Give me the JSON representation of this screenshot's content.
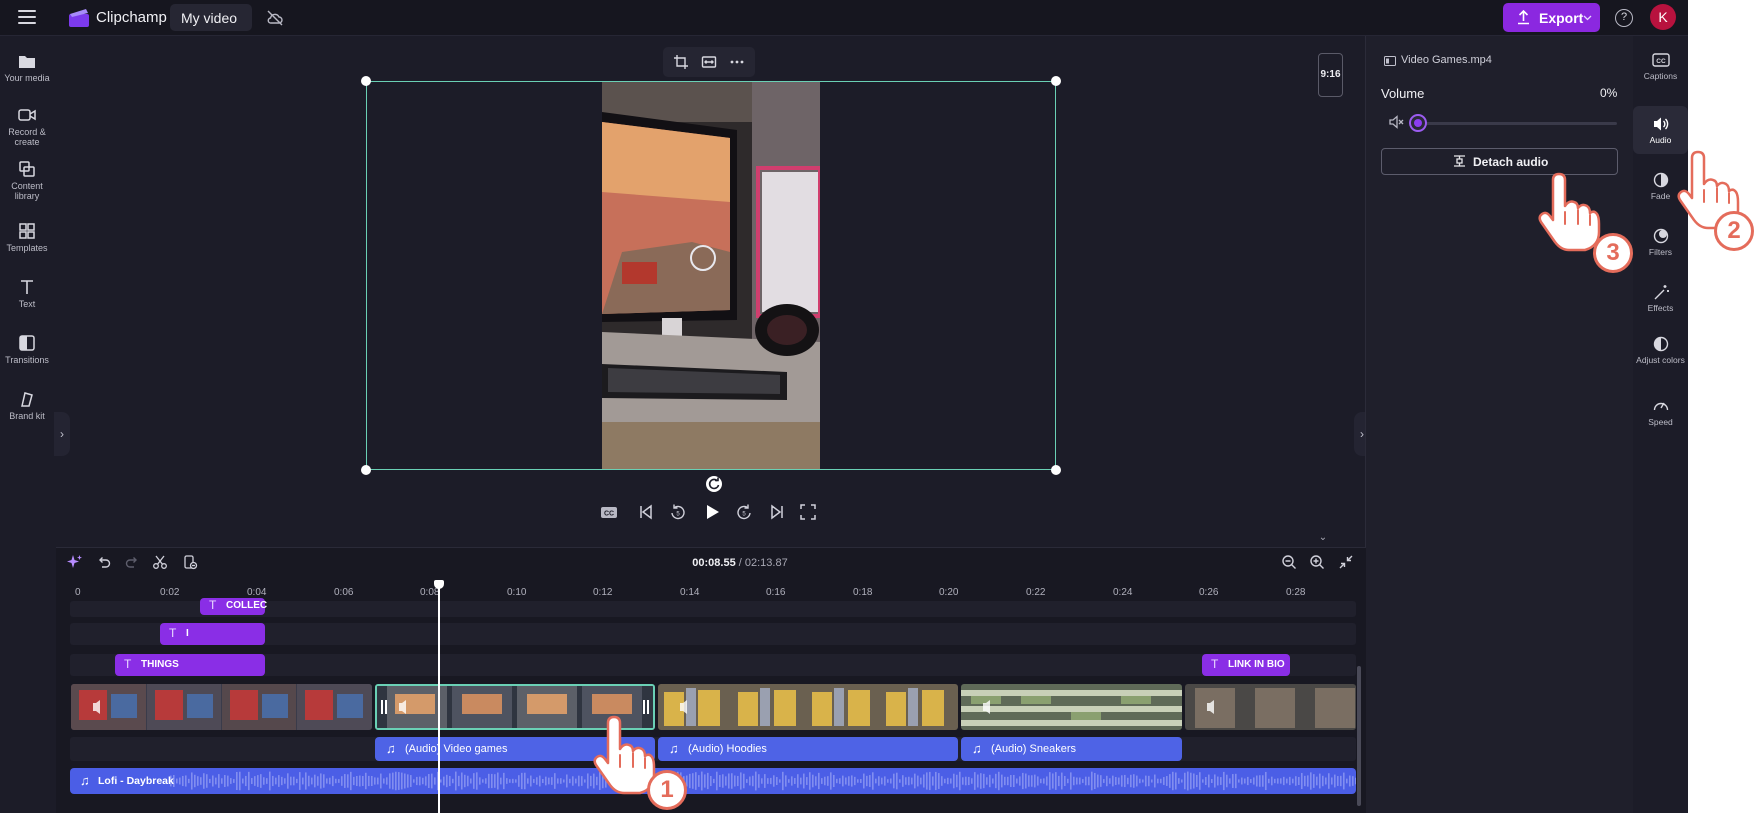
{
  "app": {
    "name": "Clipchamp",
    "project_name": "My video"
  },
  "header": {
    "export_label": "Export",
    "help_label": "?",
    "avatar_initial": "K"
  },
  "sidebar": {
    "items": [
      {
        "label": "Your media",
        "icon": "folder-icon"
      },
      {
        "label": "Record & create",
        "icon": "camera-icon"
      },
      {
        "label": "Content library",
        "icon": "library-icon"
      },
      {
        "label": "Templates",
        "icon": "templates-icon"
      },
      {
        "label": "Text",
        "icon": "text-icon"
      },
      {
        "label": "Transitions",
        "icon": "transitions-icon"
      },
      {
        "label": "Brand kit",
        "icon": "brand-kit-icon"
      }
    ]
  },
  "preview": {
    "aspect_ratio": "9:16"
  },
  "panel": {
    "file_name": "Video Games.mp4",
    "volume_label": "Volume",
    "volume_value": "0%",
    "volume_level": 0,
    "detach_label": "Detach audio"
  },
  "right_tabs": [
    {
      "label": "Captions",
      "icon": "captions-icon"
    },
    {
      "label": "Audio",
      "icon": "audio-icon",
      "active": true
    },
    {
      "label": "Fade",
      "icon": "fade-icon"
    },
    {
      "label": "Filters",
      "icon": "filters-icon"
    },
    {
      "label": "Effects",
      "icon": "effects-icon"
    },
    {
      "label": "Adjust colors",
      "icon": "adjust-colors-icon"
    },
    {
      "label": "Speed",
      "icon": "speed-icon"
    }
  ],
  "timeline": {
    "current_time": "00:08.55",
    "total_time": "/ 02:13.87",
    "ruler_labels": [
      "0",
      "0:02",
      "0:04",
      "0:06",
      "0:08",
      "0:10",
      "0:12",
      "0:14",
      "0:16",
      "0:18",
      "0:20",
      "0:22",
      "0:24",
      "0:26",
      "0:28"
    ],
    "text_clips": [
      "COLLEC",
      "I",
      "THINGS",
      "LINK IN BIO"
    ],
    "audio_clips": [
      "(Audio) Video games",
      "(Audio) Hoodies",
      "(Audio) Sneakers"
    ],
    "music_track": "Lofi - Daybreak"
  },
  "annotations": {
    "step1": "1",
    "step2": "2",
    "step3": "3"
  },
  "colors": {
    "accent": "#8b28e0",
    "selection": "#6ad0b5",
    "audio_clip": "#4e63e6",
    "text_clip": "#8a2ee6",
    "pointer_badge": "#e46c5b"
  }
}
